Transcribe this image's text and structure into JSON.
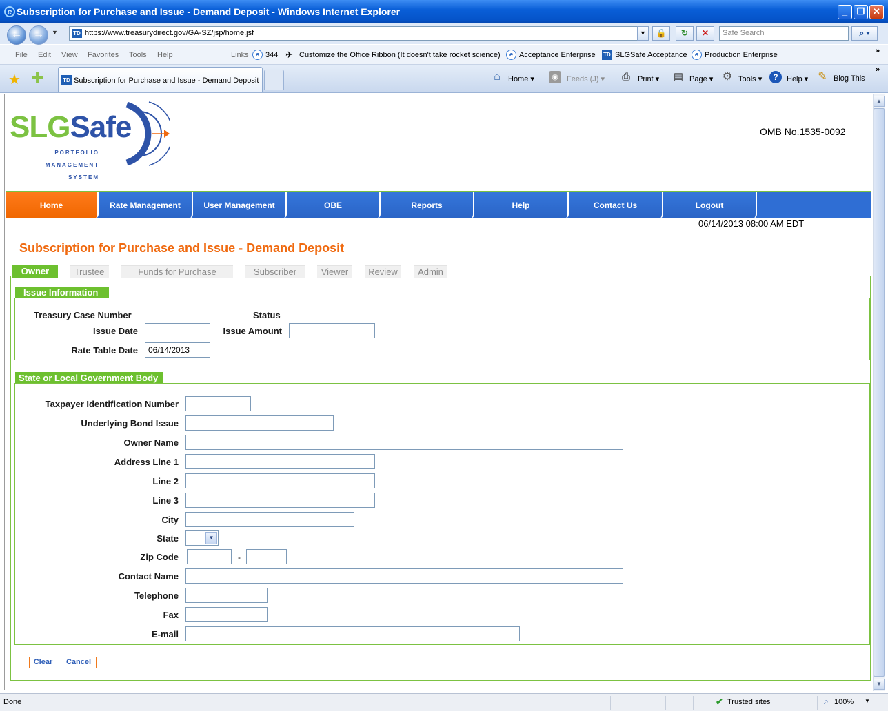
{
  "window": {
    "title": "Subscription for Purchase and Issue - Demand Deposit - Windows Internet Explorer"
  },
  "address": {
    "url": "https://www.treasurydirect.gov/GA-SZ/jsp/home.jsf",
    "search_placeholder": "Safe Search"
  },
  "menu": [
    "File",
    "Edit",
    "View",
    "Favorites",
    "Tools",
    "Help"
  ],
  "links": {
    "label": "Links",
    "items": [
      "344",
      "Customize the Office Ribbon (It doesn't take rocket science)",
      "Acceptance Enterprise",
      "SLGSafe Acceptance",
      "Production Enterprise"
    ]
  },
  "browser_tab": {
    "title": "Subscription for Purchase and Issue - Demand Deposit"
  },
  "commands": {
    "home": "Home",
    "feeds": "Feeds (J)",
    "print": "Print",
    "page": "Page",
    "tools": "Tools",
    "help": "Help",
    "blog": "Blog This"
  },
  "logo": {
    "slg": "SLG",
    "safe": "Safe",
    "line1": "PORTFOLIO",
    "line2": "MANAGEMENT",
    "line3": "SYSTEM"
  },
  "omb": "OMB No.1535-0092",
  "nav": [
    "Home",
    "Rate Management",
    "User Management",
    "OBE",
    "Reports",
    "Help",
    "Contact Us",
    "Logout"
  ],
  "datetime": "06/14/2013 08:00 AM EDT",
  "page_title": "Subscription for Purchase and Issue - Demand Deposit",
  "subtabs": [
    "Owner",
    "Trustee",
    "Funds for Purchase",
    "Subscriber",
    "Viewer",
    "Review",
    "Admin"
  ],
  "issue": {
    "heading": "Issue Information",
    "case_number_label": "Treasury Case Number",
    "status_label": "Status",
    "issue_date_label": "Issue Date",
    "issue_date_value": "",
    "issue_amount_label": "Issue Amount",
    "issue_amount_value": "",
    "rate_table_date_label": "Rate Table Date",
    "rate_table_date_value": "06/14/2013"
  },
  "govt": {
    "heading": "State or Local Government Body",
    "tin": "Taxpayer Identification Number",
    "bond": "Underlying Bond Issue",
    "owner": "Owner Name",
    "addr1": "Address Line 1",
    "line2": "Line 2",
    "line3": "Line 3",
    "city": "City",
    "state": "State",
    "zip": "Zip Code",
    "zip_sep": "-",
    "contact": "Contact Name",
    "phone": "Telephone",
    "fax": "Fax",
    "email": "E-mail"
  },
  "actions": {
    "clear": "Clear",
    "cancel": "Cancel"
  },
  "status": {
    "left": "Done",
    "zone": "Trusted sites",
    "zoom": "100%"
  },
  "colors": {
    "accent_orange": "#f06a10",
    "green": "#6dc02f",
    "nav_blue": "#2f6ed4"
  }
}
